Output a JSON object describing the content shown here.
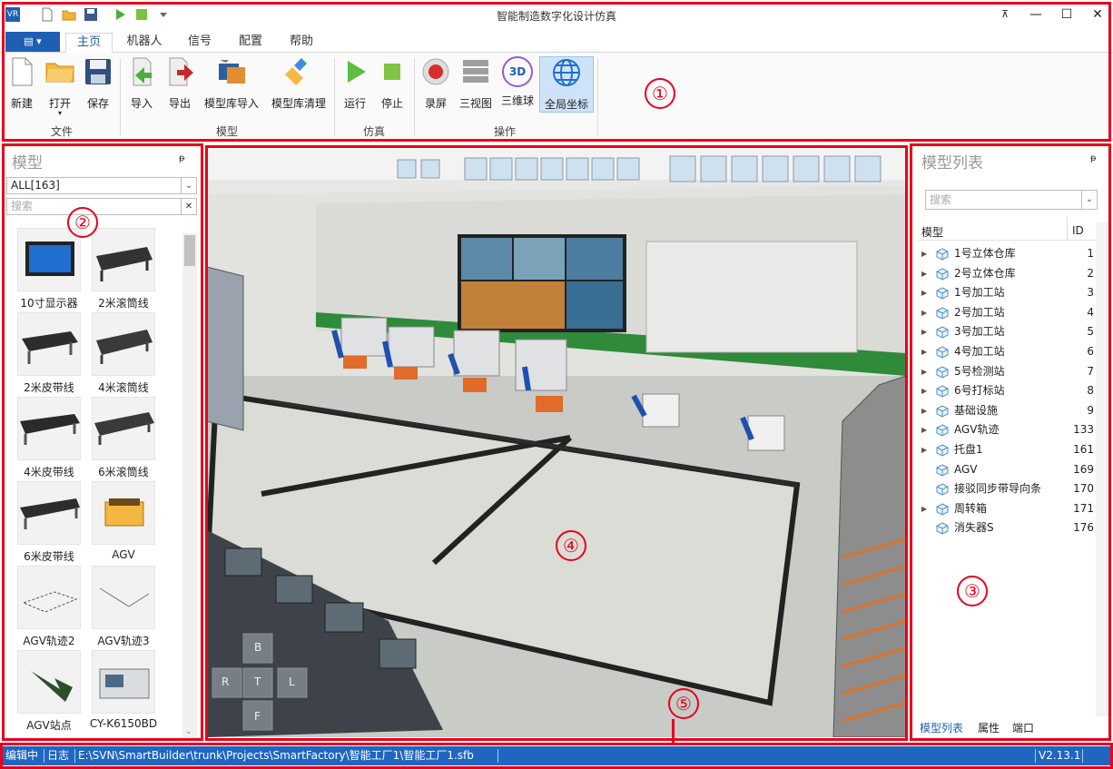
{
  "window": {
    "title": "智能制造数字化设计仿真",
    "app_logo": "VR"
  },
  "tabs": {
    "file_label": "▤ ▾",
    "items": [
      {
        "label": "主页",
        "active": true
      },
      {
        "label": "机器人"
      },
      {
        "label": "信号"
      },
      {
        "label": "配置"
      },
      {
        "label": "帮助"
      }
    ]
  },
  "ribbon": {
    "new": "新建",
    "open": "打开",
    "save": "保存",
    "import": "导入",
    "export": "导出",
    "model_lib_import": "模型库导入",
    "model_lib_clear": "模型库清理",
    "run": "运行",
    "stop": "停止",
    "record": "录屏",
    "three_view": "三视图",
    "globe_3d": "三维球",
    "global_coord": "全局坐标",
    "group_file": "文件",
    "group_model": "模型",
    "group_sim": "仿真",
    "group_ops": "操作",
    "globe_badge": "3D"
  },
  "left_panel": {
    "title": "模型",
    "pin": "ᵽ",
    "filter_value": "ALL[163]",
    "search_placeholder": "搜索",
    "items": [
      {
        "label": "10寸显示器"
      },
      {
        "label": "2米滚筒线"
      },
      {
        "label": "2米皮带线"
      },
      {
        "label": "4米滚筒线"
      },
      {
        "label": "4米皮带线"
      },
      {
        "label": "6米滚筒线"
      },
      {
        "label": "6米皮带线"
      },
      {
        "label": "AGV"
      },
      {
        "label": "AGV轨迹2"
      },
      {
        "label": "AGV轨迹3"
      },
      {
        "label": "AGV站点"
      },
      {
        "label": "CY-K6150BD"
      }
    ]
  },
  "viewport": {
    "nav": {
      "up": "B",
      "left": "R",
      "center": "T",
      "right": "L",
      "down": "F"
    }
  },
  "right_panel": {
    "title": "模型列表",
    "pin": "ᵽ",
    "search_placeholder": "搜索",
    "col_model": "模型",
    "col_id": "ID",
    "rows": [
      {
        "name": "1号立体仓库",
        "id": "1",
        "expandable": true
      },
      {
        "name": "2号立体仓库",
        "id": "2",
        "expandable": true
      },
      {
        "name": "1号加工站",
        "id": "3",
        "expandable": true
      },
      {
        "name": "2号加工站",
        "id": "4",
        "expandable": true
      },
      {
        "name": "3号加工站",
        "id": "5",
        "expandable": true
      },
      {
        "name": "4号加工站",
        "id": "6",
        "expandable": true
      },
      {
        "name": "5号检测站",
        "id": "7",
        "expandable": true
      },
      {
        "name": "6号打标站",
        "id": "8",
        "expandable": true
      },
      {
        "name": "基础设施",
        "id": "9",
        "expandable": true
      },
      {
        "name": "AGV轨迹",
        "id": "133",
        "expandable": true
      },
      {
        "name": "托盘1",
        "id": "161",
        "expandable": true
      },
      {
        "name": "AGV",
        "id": "169",
        "expandable": false
      },
      {
        "name": "接驳同步带导向条",
        "id": "170",
        "expandable": false
      },
      {
        "name": "周转箱",
        "id": "171",
        "expandable": true
      },
      {
        "name": "消失器S",
        "id": "176",
        "expandable": false
      }
    ],
    "bottom_tabs": [
      "模型列表",
      "属性",
      "端口"
    ]
  },
  "status_bar": {
    "mode": "编辑中",
    "log": "日志",
    "path": "E:\\SVN\\SmartBuilder\\trunk\\Projects\\SmartFactory\\智能工厂1\\智能工厂1.sfb",
    "version": "V2.13.1"
  },
  "annotations": [
    "①",
    "②",
    "③",
    "④",
    "⑤"
  ],
  "colors": {
    "accent": "#1f66c1",
    "annotation": "#e8001c"
  }
}
